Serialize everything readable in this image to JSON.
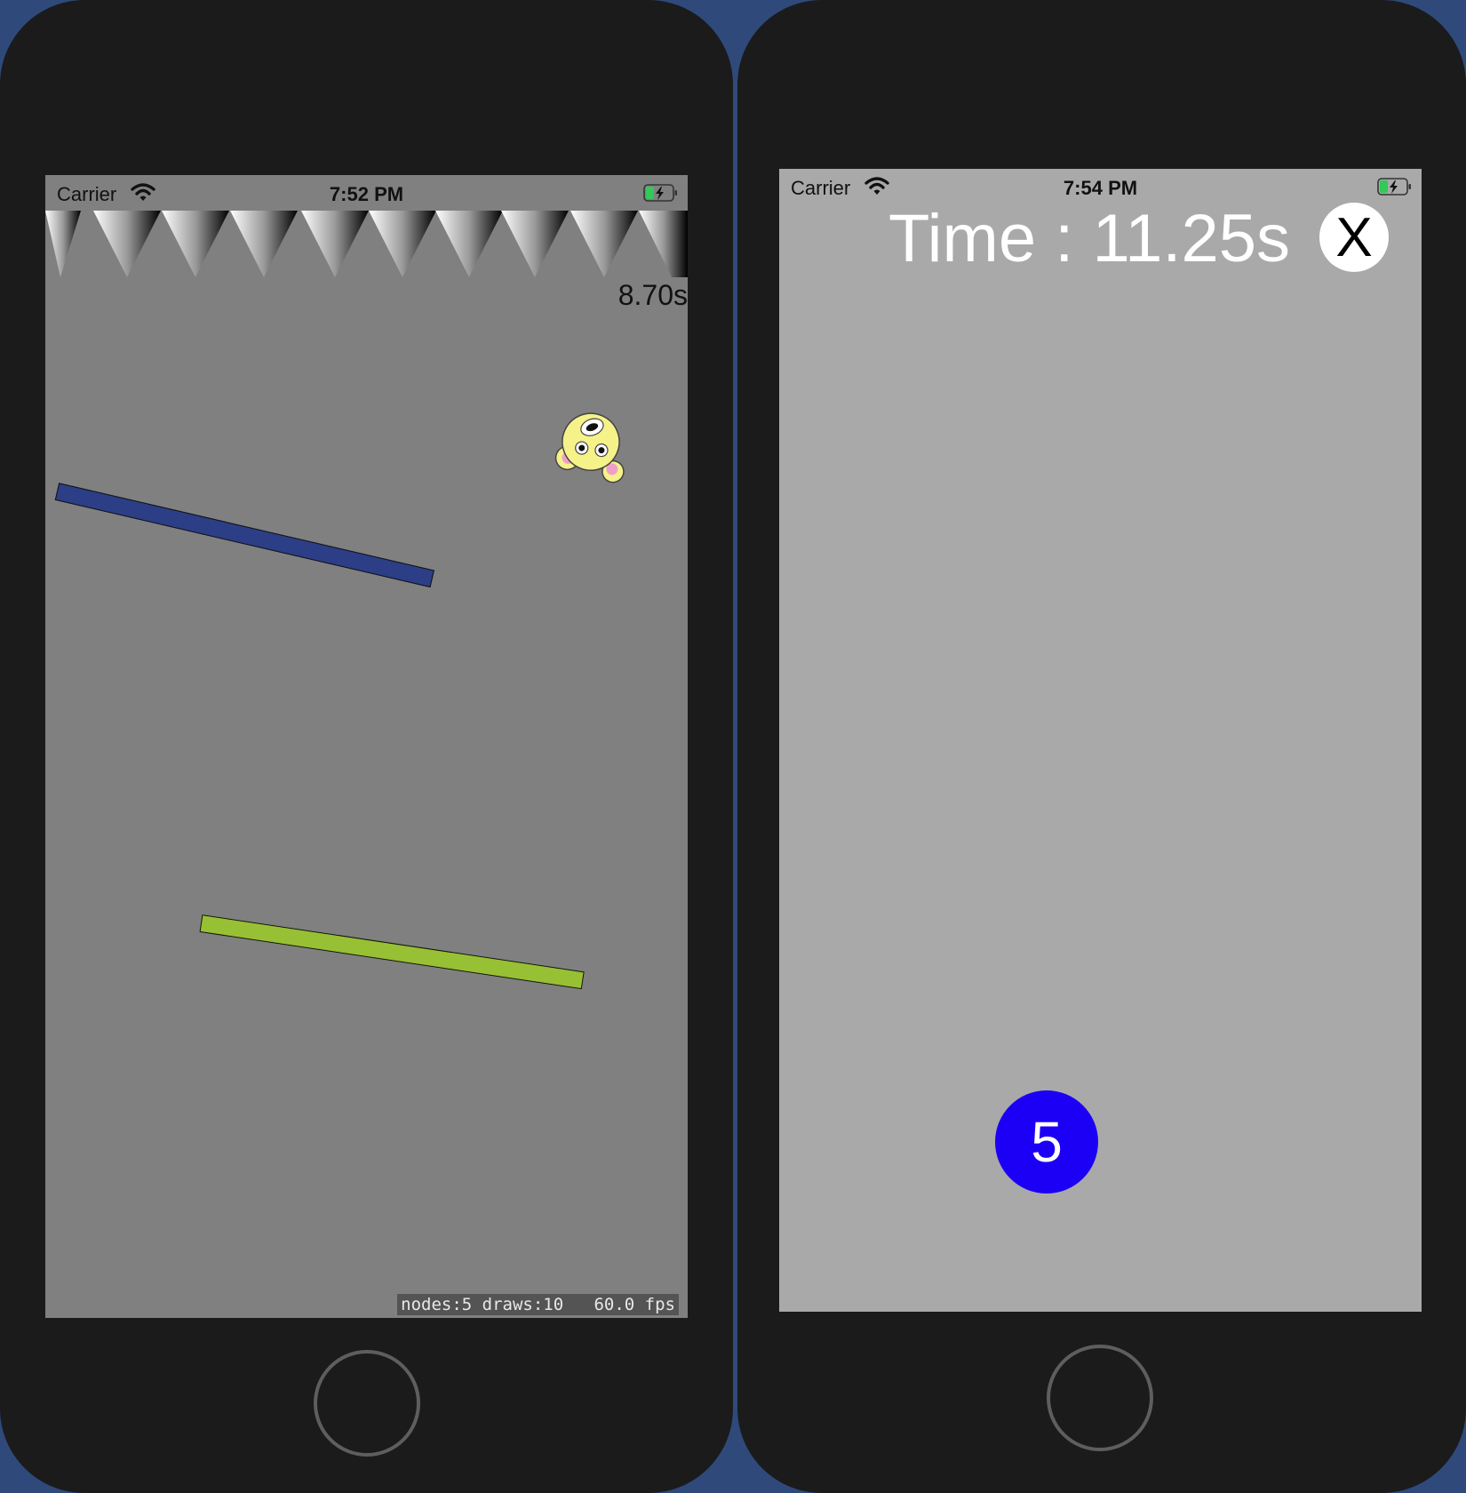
{
  "left_device": {
    "status_bar": {
      "carrier": "Carrier",
      "time": "7:52 PM",
      "icons": [
        "wifi-icon",
        "battery-charging-icon"
      ]
    },
    "timer": "8.70s",
    "stats_overlay": "nodes:5 draws:10   60.0 fps",
    "platform_colors": {
      "blue": "#2c3e86",
      "green": "#97c034"
    }
  },
  "right_device": {
    "status_bar": {
      "carrier": "Carrier",
      "time": "7:54 PM",
      "icons": [
        "wifi-icon",
        "battery-charging-icon"
      ]
    },
    "timer": "Time : 11.25s",
    "close_label": "X",
    "count_value": "5",
    "colors": {
      "ball": "#1c00f5",
      "background": "#a9a9a9"
    }
  }
}
